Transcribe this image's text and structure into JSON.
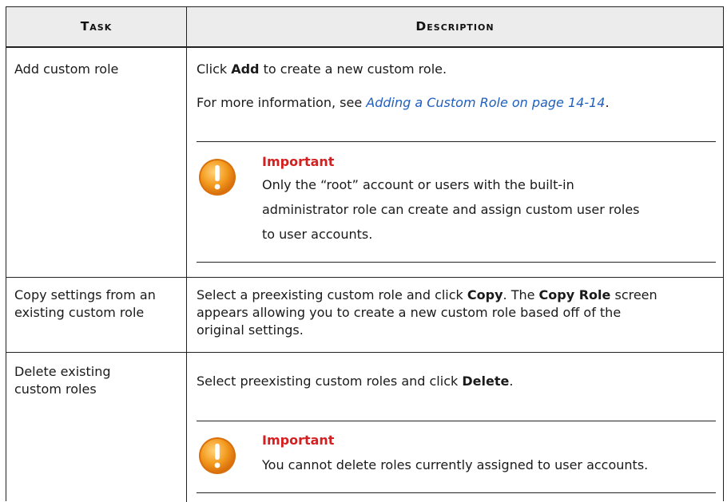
{
  "table": {
    "header": {
      "task": "Task",
      "description": "Description"
    },
    "rows": [
      {
        "task": "Add custom role",
        "desc_pre": "Click ",
        "desc_bold": "Add",
        "desc_post": " to create a new custom role.",
        "info_pre": "For more information, see ",
        "info_link": "Adding a Custom Role on page 14-14",
        "info_post": ".",
        "note_label": "Important",
        "note_lines": [
          "Only the “root” account or users with the built-in",
          "administrator role can create and assign custom user roles",
          "to user accounts."
        ]
      },
      {
        "task_lines": [
          "Copy settings from an",
          "existing custom role"
        ],
        "desc_a": "Select a preexisting custom role and click ",
        "desc_b": "Copy",
        "desc_c": ". The ",
        "desc_d": "Copy Role",
        "desc_e": " screen",
        "desc_line2": "appears allowing you to create a new custom role based off of the",
        "desc_line3": "original settings."
      },
      {
        "task_lines": [
          "Delete existing",
          "custom roles"
        ],
        "desc_pre": "Select preexisting custom roles and click ",
        "desc_bold": "Delete",
        "desc_post": ".",
        "note_label": "Important",
        "note_text": "You cannot delete roles currently assigned to user accounts."
      }
    ]
  },
  "icons": {
    "important": "warning-exclamation-icon"
  },
  "colors": {
    "note_label": "#d42020",
    "link": "#1f5fbf",
    "icon_orange": "#f39a1e"
  }
}
